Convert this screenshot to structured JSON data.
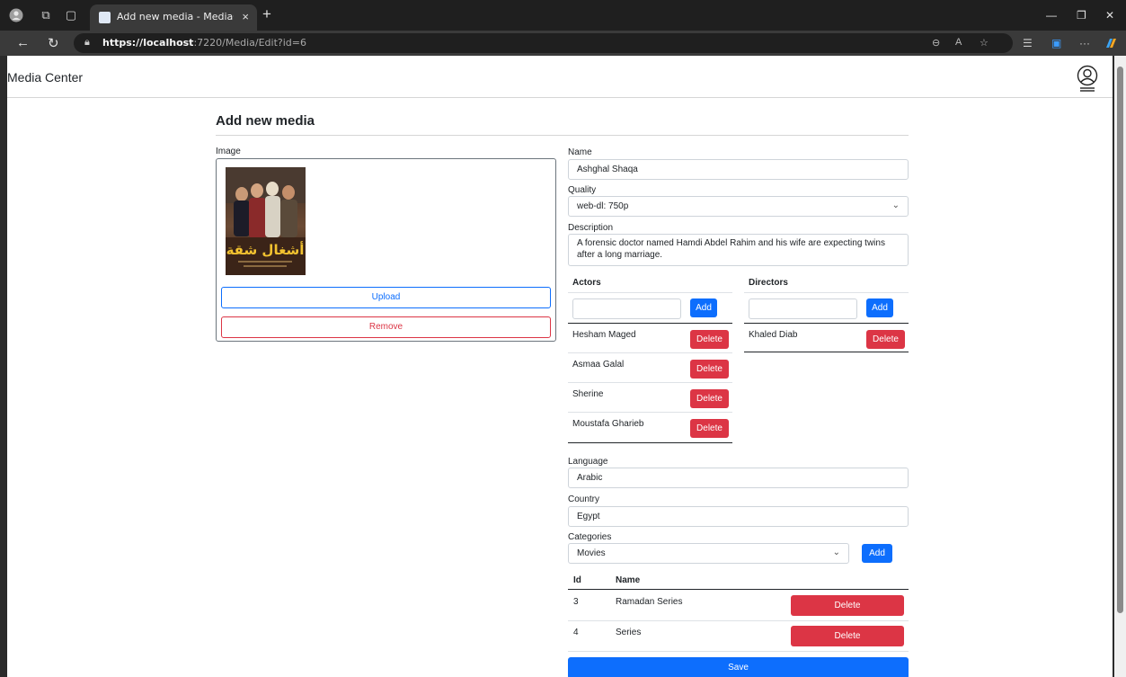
{
  "browser": {
    "tab_title": "Add new media - MediaCenterAd",
    "tab_close": "×",
    "new_tab": "+",
    "url_host": "https://localhost",
    "url_path": ":7220/Media/Edit?id=6",
    "read_aloud": "A",
    "more": "···"
  },
  "navbar": {
    "brand": "Media Center"
  },
  "form": {
    "heading": "Add new media",
    "image_label": "Image",
    "upload_label": "Upload",
    "remove_label": "Remove",
    "name_label": "Name",
    "name_value": "Ashghal Shaqa",
    "quality_label": "Quality",
    "quality_value": "web-dl: 750p",
    "description_label": "Description",
    "description_value": "A forensic doctor named Hamdi Abdel Rahim and his wife are expecting twins after a long marriage.",
    "language_label": "Language",
    "language_value": "Arabic",
    "country_label": "Country",
    "country_value": "Egypt",
    "categories_label": "Categories",
    "categories_value": "Movies",
    "save_label": "Save"
  },
  "actors": {
    "header": "Actors",
    "add_label": "Add",
    "delete_label": "Delete",
    "items": [
      "Hesham Maged",
      "Asmaa Galal",
      "Sherine",
      "Moustafa Gharieb"
    ]
  },
  "directors": {
    "header": "Directors",
    "add_label": "Add",
    "delete_label": "Delete",
    "items": [
      "Khaled Diab"
    ]
  },
  "categories": {
    "add_label": "Add",
    "col_id": "Id",
    "col_name": "Name",
    "delete_label": "Delete",
    "rows": [
      {
        "id": "3",
        "name": "Ramadan Series"
      },
      {
        "id": "4",
        "name": "Series"
      }
    ]
  },
  "poster": {
    "title_text": "أشغال شقة"
  }
}
